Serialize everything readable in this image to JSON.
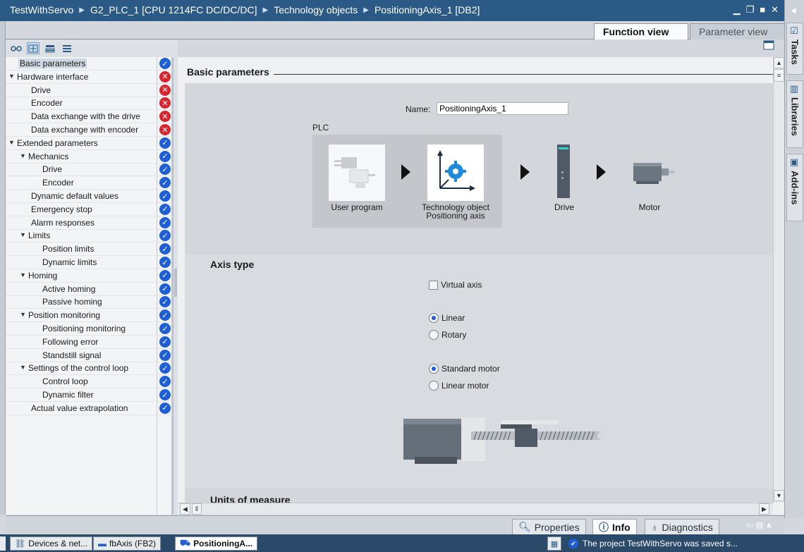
{
  "title_bar": {
    "crumbs": [
      "TestWithServo",
      "G2_PLC_1 [CPU 1214FC DC/DC/DC]",
      "Technology objects",
      "PositioningAxis_1 [DB2]"
    ]
  },
  "view_tabs": {
    "function_view": "Function view",
    "parameter_view": "Parameter view"
  },
  "tree": {
    "items": [
      {
        "label": "Basic parameters",
        "status": "ok"
      },
      {
        "label": "Hardware interface",
        "status": "err"
      },
      {
        "label": "Drive",
        "status": "err"
      },
      {
        "label": "Encoder",
        "status": "err"
      },
      {
        "label": "Data exchange with the drive",
        "status": "err"
      },
      {
        "label": "Data exchange with encoder",
        "status": "err"
      },
      {
        "label": "Extended parameters",
        "status": "ok"
      },
      {
        "label": "Mechanics",
        "status": "ok"
      },
      {
        "label": "Drive",
        "status": "ok"
      },
      {
        "label": "Encoder",
        "status": "ok"
      },
      {
        "label": "Dynamic default values",
        "status": "ok"
      },
      {
        "label": "Emergency stop",
        "status": "ok"
      },
      {
        "label": "Alarm responses",
        "status": "ok"
      },
      {
        "label": "Limits",
        "status": "ok"
      },
      {
        "label": "Position limits",
        "status": "ok"
      },
      {
        "label": "Dynamic limits",
        "status": "ok"
      },
      {
        "label": "Homing",
        "status": "ok"
      },
      {
        "label": "Active homing",
        "status": "ok"
      },
      {
        "label": "Passive homing",
        "status": "ok"
      },
      {
        "label": "Position monitoring",
        "status": "ok"
      },
      {
        "label": "Positioning monitoring",
        "status": "ok"
      },
      {
        "label": "Following error",
        "status": "ok"
      },
      {
        "label": "Standstill signal",
        "status": "ok"
      },
      {
        "label": "Settings of the control loop",
        "status": "ok"
      },
      {
        "label": "Control loop",
        "status": "ok"
      },
      {
        "label": "Dynamic filter",
        "status": "ok"
      },
      {
        "label": "Actual value extrapolation",
        "status": "ok"
      }
    ]
  },
  "basic": {
    "heading": "Basic parameters",
    "name_label": "Name:",
    "name_value": "PositioningAxis_1",
    "plc_label": "PLC",
    "user_program": "User program",
    "techobj_line1": "Technology object",
    "techobj_line2": "Positioning axis",
    "drive": "Drive",
    "motor": "Motor"
  },
  "axis_type": {
    "heading": "Axis type",
    "virtual_axis": "Virtual axis",
    "linear": "Linear",
    "rotary": "Rotary",
    "standard_motor": "Standard motor",
    "linear_motor": "Linear motor"
  },
  "units": {
    "heading": "Units of measure"
  },
  "right_tabs": {
    "tasks": "Tasks",
    "libraries": "Libraries",
    "addins": "Add-ins"
  },
  "inspector": {
    "properties": "Properties",
    "info": "Info",
    "diagnostics": "Diagnostics"
  },
  "taskbar": {
    "items": [
      "Devices & net...",
      "fbAxis (FB2)",
      "PositioningA..."
    ],
    "status": "The project TestWithServo was saved s..."
  },
  "colors": {
    "title": "#2b5a86",
    "ok": "#1f5fd6",
    "err": "#d9262e"
  }
}
